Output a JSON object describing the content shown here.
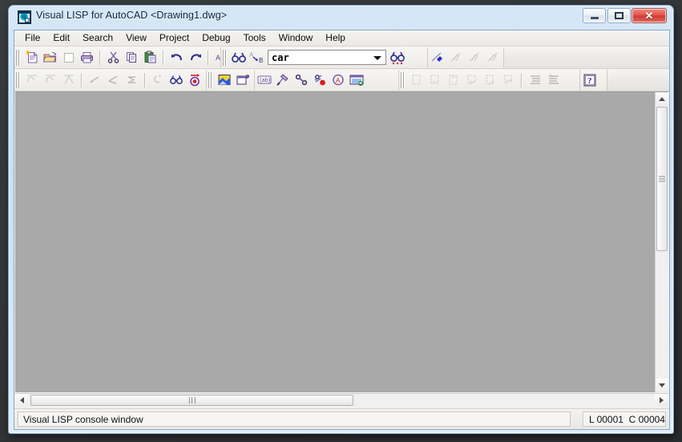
{
  "window": {
    "title": "Visual LISP for AutoCAD <Drawing1.dwg>",
    "icon": "visual-lisp-app-icon",
    "caption_buttons": {
      "minimize": "minimize-button",
      "maximize": "maximize-button",
      "close": "close-button",
      "close_glyph": "✕"
    }
  },
  "menubar": {
    "items": [
      {
        "label": "File"
      },
      {
        "label": "Edit"
      },
      {
        "label": "Search"
      },
      {
        "label": "View"
      },
      {
        "label": "Project"
      },
      {
        "label": "Debug"
      },
      {
        "label": "Tools"
      },
      {
        "label": "Window"
      },
      {
        "label": "Help"
      }
    ]
  },
  "toolbars": {
    "standard": {
      "buttons": [
        {
          "icon": "new-file-icon",
          "enabled": true
        },
        {
          "icon": "open-folder-icon",
          "enabled": true
        },
        {
          "icon": "save-file-icon",
          "enabled": false
        },
        {
          "icon": "print-icon",
          "enabled": true
        },
        {
          "icon": "cut-scissors-icon",
          "enabled": true
        },
        {
          "icon": "copy-icon",
          "enabled": true
        },
        {
          "icon": "paste-clipboard-icon",
          "enabled": true
        },
        {
          "icon": "undo-arrow-icon",
          "enabled": true
        },
        {
          "icon": "redo-arrow-icon",
          "enabled": true
        },
        {
          "icon": "complete-word-icon",
          "enabled": true
        }
      ]
    },
    "search": {
      "buttons": [
        {
          "icon": "find-binoculars-icon",
          "enabled": true
        },
        {
          "icon": "replace-ab-icon",
          "enabled": true
        }
      ],
      "combo": {
        "name": "find-combo",
        "value": "car",
        "placeholder": ""
      },
      "find_next": {
        "icon": "find-next-binoculars-icon",
        "enabled": true
      }
    },
    "debug_run": {
      "buttons": [
        {
          "icon": "load-active-edit-window-icon",
          "enabled": true
        },
        {
          "icon": "load-selection-icon",
          "enabled": false
        },
        {
          "icon": "check-text-icon",
          "enabled": false
        },
        {
          "icon": "format-code-icon",
          "enabled": false
        }
      ]
    },
    "debug_step": {
      "buttons": [
        {
          "icon": "step-into-icon",
          "enabled": false
        },
        {
          "icon": "step-over-icon",
          "enabled": false
        },
        {
          "icon": "step-out-icon",
          "enabled": false
        },
        {
          "icon": "continue-icon",
          "enabled": false
        },
        {
          "icon": "quit-current-level-icon",
          "enabled": false
        },
        {
          "icon": "reset-to-top-level-icon",
          "enabled": false
        },
        {
          "icon": "stop-once-icon",
          "enabled": false
        },
        {
          "icon": "toggle-breakpoint-icon",
          "enabled": true
        },
        {
          "icon": "last-break-icon",
          "enabled": true
        }
      ]
    },
    "view": {
      "buttons": [
        {
          "icon": "select-window-icon",
          "enabled": true
        },
        {
          "icon": "visual-lisp-console-icon",
          "enabled": true
        }
      ]
    },
    "tools": {
      "buttons": [
        {
          "icon": "inspect-ab-icon",
          "enabled": true
        },
        {
          "icon": "trace-stack-icon",
          "enabled": true
        },
        {
          "icon": "symbol-service-icon",
          "enabled": true
        },
        {
          "icon": "apropos-window-icon",
          "enabled": true
        },
        {
          "icon": "watch-window-icon",
          "enabled": true
        },
        {
          "icon": "bind-window-icon",
          "enabled": true
        }
      ]
    },
    "comment": {
      "buttons": [
        {
          "icon": "copy-to-new-icon",
          "enabled": false
        },
        {
          "icon": "append-icon",
          "enabled": false
        },
        {
          "icon": "new-paste-icon",
          "enabled": false
        },
        {
          "icon": "append-paste-icon",
          "enabled": false
        },
        {
          "icon": "copy-line-icon",
          "enabled": false
        },
        {
          "icon": "paste-line-icon",
          "enabled": false
        },
        {
          "icon": "comment-block-icon",
          "enabled": false
        },
        {
          "icon": "uncomment-block-icon",
          "enabled": false
        }
      ]
    },
    "help": {
      "buttons": [
        {
          "icon": "help-question-icon",
          "enabled": true
        }
      ]
    }
  },
  "console": {
    "name": "visual-lisp-console-surface",
    "background": "#a9a9a9",
    "text": ""
  },
  "scrollbars": {
    "vertical": {
      "up_arrow": "scroll-up-arrow",
      "down_arrow": "scroll-down-arrow",
      "thumb": "vertical-scroll-thumb"
    },
    "horizontal": {
      "left_arrow": "scroll-left-arrow",
      "right_arrow": "scroll-right-arrow",
      "thumb": "horizontal-scroll-thumb"
    }
  },
  "statusbar": {
    "message": "Visual LISP console window",
    "position": "L 00001  C 00004"
  },
  "colors": {
    "frame": "#c9dff4",
    "frame_border": "#7ea6cc",
    "client": "#f1f0ee",
    "console": "#a9a9a9",
    "toolbar": "#eceae6",
    "close_button": "#cf3b33",
    "icon_purple": "#7b5fa8",
    "icon_blue": "#2b2bcc",
    "icon_yellow": "#f2d432",
    "disabled_gray": "#bdbdbd"
  }
}
